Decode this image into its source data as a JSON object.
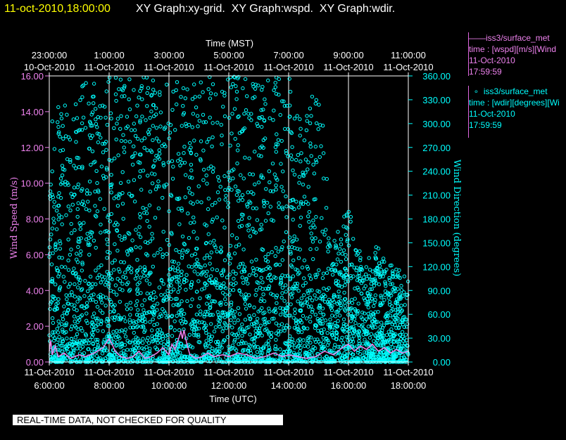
{
  "header": {
    "timestamp": "11-oct-2010,18:00:00",
    "titles": "XY Graph:xy-grid.  XY Graph:wspd.  XY Graph:wdir."
  },
  "legend": [
    {
      "color": "#ee82ee",
      "line1": "——iss3/surface_met",
      "line2": "time : [wspd][m/s][Wind",
      "line3": "11-Oct-2010",
      "line4": "17:59:59"
    },
    {
      "color": "#00ffff",
      "line1": "  ∘  iss3/surface_met",
      "line2": "time : [wdir][degrees][Wi",
      "line3": "11-Oct-2010",
      "line4": "17:59:59"
    }
  ],
  "notice": "REAL-TIME DATA, NOT CHECKED FOR QUALITY",
  "colors": {
    "wspd": "#ee82ee",
    "wdir": "#00ffff",
    "text": "#ffffff",
    "header_time": "#ffff00",
    "grid": "#ffffff"
  },
  "chart_data": {
    "type": "line+scatter",
    "x_top_label": "Time (MST)",
    "x_bottom_label": "Time (UTC)",
    "x_top_ticks": [
      {
        "time": "23:00:00",
        "date": "10-Oct-2010"
      },
      {
        "time": "1:00:00",
        "date": "11-Oct-2010"
      },
      {
        "time": "3:00:00",
        "date": "11-Oct-2010"
      },
      {
        "time": "5:00:00",
        "date": "11-Oct-2010"
      },
      {
        "time": "7:00:00",
        "date": "11-Oct-2010"
      },
      {
        "time": "9:00:00",
        "date": "11-Oct-2010"
      },
      {
        "time": "11:00:00",
        "date": "11-Oct-2010"
      }
    ],
    "x_bottom_ticks": [
      {
        "date": "11-Oct-2010",
        "time": "6:00:00"
      },
      {
        "date": "11-Oct-2010",
        "time": "8:00:00"
      },
      {
        "date": "11-Oct-2010",
        "time": "10:00:00"
      },
      {
        "date": "11-Oct-2010",
        "time": "12:00:00"
      },
      {
        "date": "11-Oct-2010",
        "time": "14:00:00"
      },
      {
        "date": "11-Oct-2010",
        "time": "16:00:00"
      },
      {
        "date": "11-Oct-2010",
        "time": "18:00:00"
      }
    ],
    "xlim_utc_hours": [
      6,
      18
    ],
    "y_left": {
      "label": "Wind Speed (m/s)",
      "range": [
        0,
        16
      ],
      "ticks": [
        "0.00",
        "2.00",
        "4.00",
        "6.00",
        "8.00",
        "10.00",
        "12.00",
        "14.00",
        "16.00"
      ]
    },
    "y_right": {
      "label": "Wind Direction (degrees)",
      "range": [
        0,
        360
      ],
      "ticks": [
        "0.00",
        "30.00",
        "60.00",
        "90.00",
        "120.00",
        "150.00",
        "180.00",
        "210.00",
        "240.00",
        "270.00",
        "300.00",
        "330.00",
        "360.00"
      ]
    },
    "grid": "vertical",
    "series": [
      {
        "name": "iss3/surface_met time : [wspd][m/s][Wind",
        "style": "line",
        "axis": "left",
        "points": [
          [
            6.0,
            0.6
          ],
          [
            6.05,
            1.2
          ],
          [
            6.1,
            0.4
          ],
          [
            6.2,
            0.9
          ],
          [
            6.3,
            0.3
          ],
          [
            6.5,
            0.5
          ],
          [
            6.7,
            0.2
          ],
          [
            7.0,
            0.4
          ],
          [
            7.2,
            0.3
          ],
          [
            7.5,
            0.5
          ],
          [
            7.8,
            0.8
          ],
          [
            8.0,
            1.3
          ],
          [
            8.1,
            1.0
          ],
          [
            8.2,
            0.6
          ],
          [
            8.4,
            0.3
          ],
          [
            8.6,
            0.2
          ],
          [
            8.8,
            0.3
          ],
          [
            9.0,
            0.6
          ],
          [
            9.2,
            0.2
          ],
          [
            9.4,
            0.3
          ],
          [
            9.6,
            0.5
          ],
          [
            9.8,
            0.8
          ],
          [
            10.0,
            0.4
          ],
          [
            10.1,
            1.0
          ],
          [
            10.2,
            0.7
          ],
          [
            10.3,
            1.2
          ],
          [
            10.4,
            1.7
          ],
          [
            10.45,
            1.3
          ],
          [
            10.5,
            1.8
          ],
          [
            10.6,
            1.0
          ],
          [
            10.7,
            0.4
          ],
          [
            10.9,
            0.2
          ],
          [
            11.1,
            0.3
          ],
          [
            11.3,
            0.5
          ],
          [
            11.5,
            0.3
          ],
          [
            11.8,
            0.4
          ],
          [
            12.0,
            0.3
          ],
          [
            12.3,
            0.5
          ],
          [
            12.6,
            0.4
          ],
          [
            12.9,
            0.2
          ],
          [
            13.2,
            0.3
          ],
          [
            13.5,
            0.5
          ],
          [
            13.8,
            0.3
          ],
          [
            14.0,
            0.4
          ],
          [
            14.3,
            0.3
          ],
          [
            14.6,
            0.2
          ],
          [
            14.9,
            0.3
          ],
          [
            15.2,
            0.6
          ],
          [
            15.5,
            0.4
          ],
          [
            15.8,
            0.8
          ],
          [
            16.0,
            1.0
          ],
          [
            16.2,
            0.6
          ],
          [
            16.4,
            0.9
          ],
          [
            16.6,
            0.7
          ],
          [
            16.8,
            1.0
          ],
          [
            17.0,
            0.6
          ],
          [
            17.2,
            0.8
          ],
          [
            17.4,
            0.5
          ],
          [
            17.6,
            0.7
          ],
          [
            17.8,
            0.5
          ],
          [
            18.0,
            0.6
          ]
        ]
      },
      {
        "name": "iss3/surface_met time : [wdir][degrees][Wi",
        "style": "scatter",
        "axis": "right",
        "description_of_density": "dense scatter spanning 0–360 degrees across all times",
        "bands": [
          [
            6.0,
            0,
            360
          ],
          [
            6.3,
            0,
            360
          ],
          [
            6.7,
            0,
            300
          ],
          [
            7.0,
            0,
            360
          ],
          [
            7.5,
            0,
            360
          ],
          [
            8.0,
            0,
            360
          ],
          [
            8.5,
            0,
            360
          ],
          [
            9.0,
            0,
            360
          ],
          [
            9.5,
            0,
            360
          ],
          [
            10.0,
            0,
            360
          ],
          [
            10.5,
            0,
            360
          ],
          [
            11.0,
            0,
            360
          ],
          [
            11.5,
            0,
            360
          ],
          [
            12.0,
            0,
            360
          ],
          [
            12.5,
            0,
            360
          ],
          [
            13.0,
            0,
            360
          ],
          [
            13.5,
            0,
            360
          ],
          [
            14.0,
            0,
            360
          ],
          [
            14.5,
            0,
            300
          ],
          [
            15.0,
            0,
            360
          ],
          [
            15.5,
            0,
            150
          ],
          [
            16.0,
            0,
            200
          ],
          [
            16.5,
            0,
            120
          ],
          [
            17.0,
            0,
            150
          ],
          [
            17.5,
            0,
            120
          ],
          [
            18.0,
            0,
            110
          ]
        ]
      }
    ]
  }
}
